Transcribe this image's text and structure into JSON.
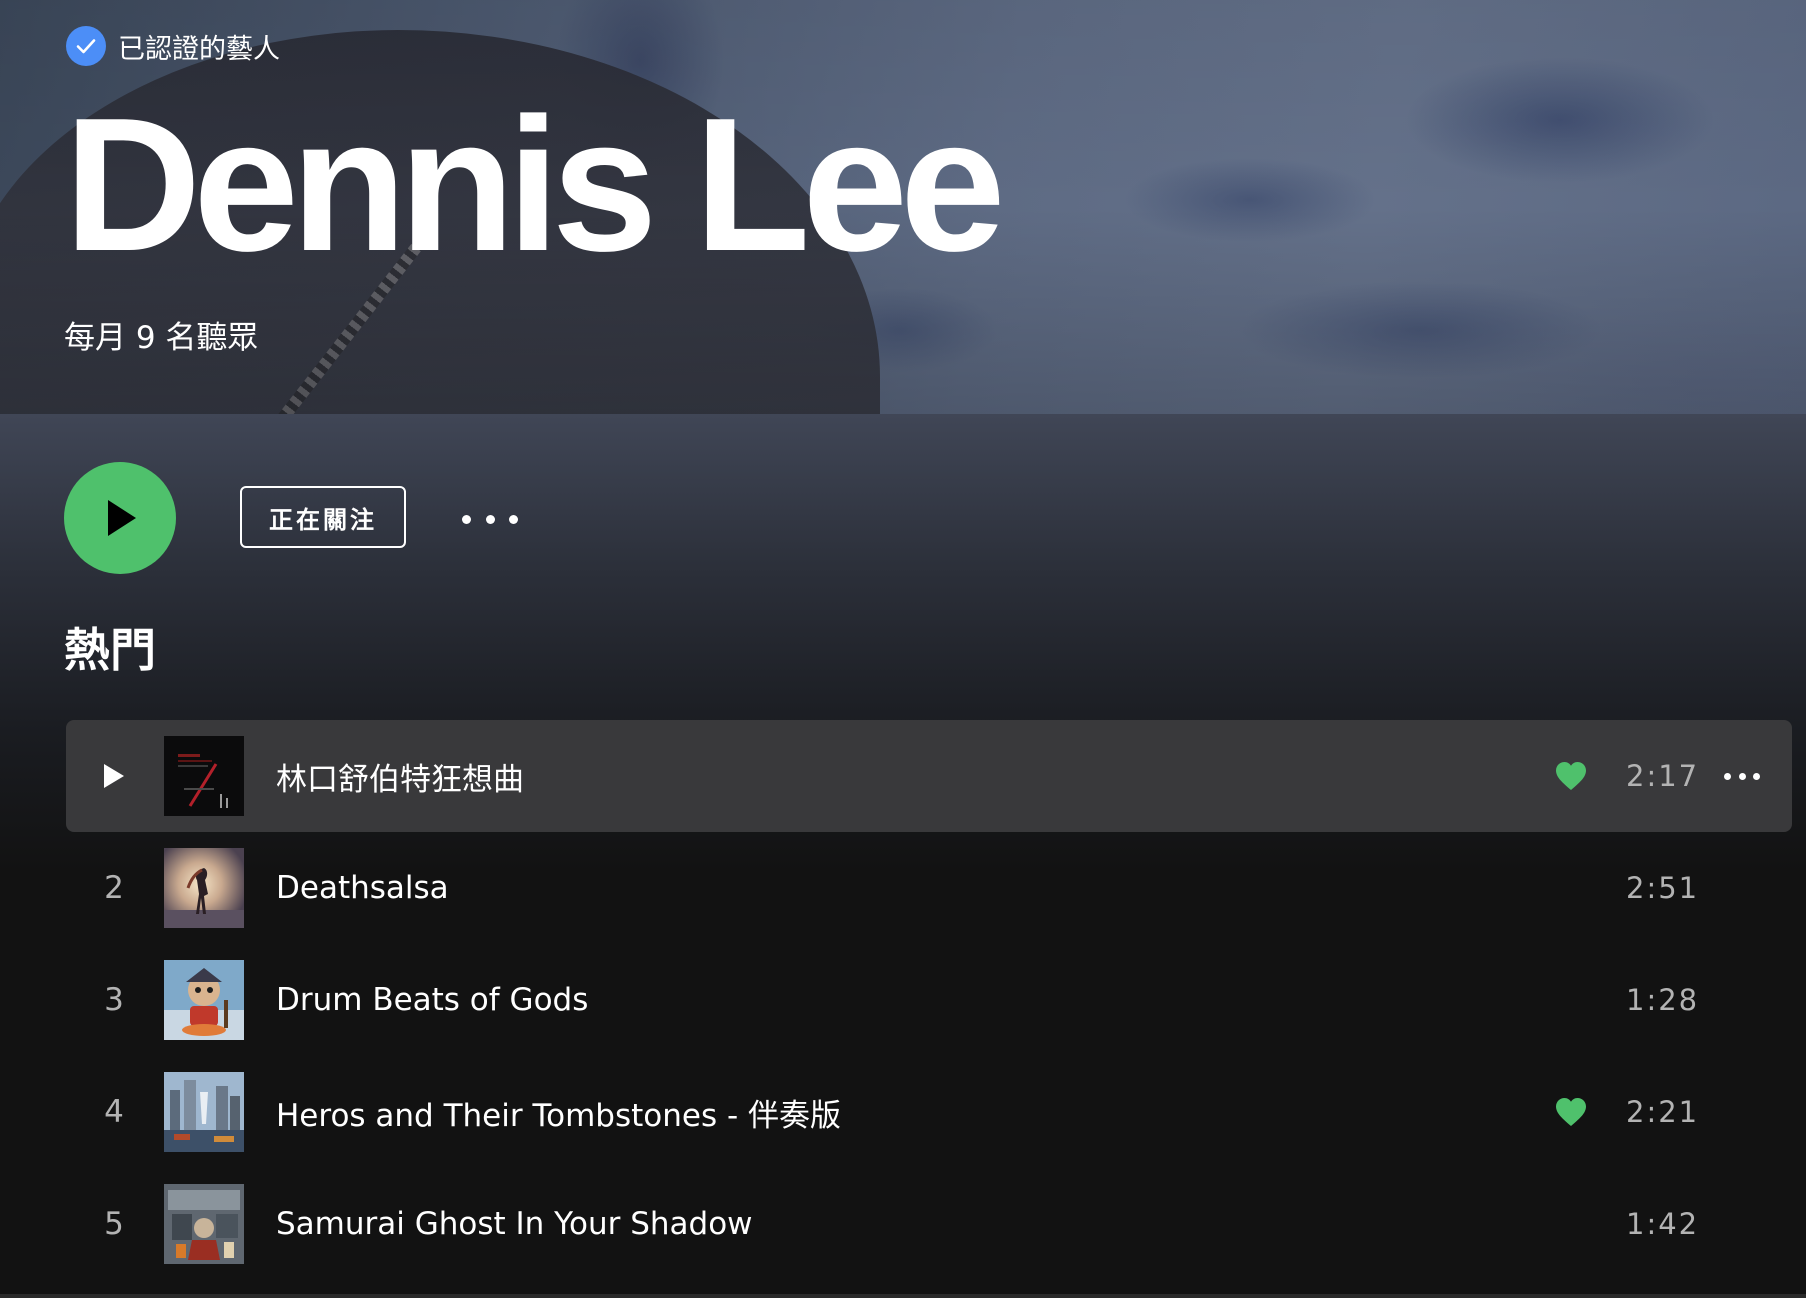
{
  "artist": {
    "verified_label": "已認證的藝人",
    "name": "Dennis Lee",
    "monthly_listeners": "每月 9 名聽眾"
  },
  "actions": {
    "follow_label": "正在關注",
    "play_icon": "play-icon",
    "more_icon": "more-icon"
  },
  "popular": {
    "section_title": "熱門",
    "tracks": [
      {
        "index": "1",
        "title": "林口舒伯特狂想曲",
        "duration": "2:17",
        "liked": true,
        "hovered": true
      },
      {
        "index": "2",
        "title": "Deathsalsa",
        "duration": "2:51",
        "liked": false,
        "hovered": false
      },
      {
        "index": "3",
        "title": "Drum Beats of Gods",
        "duration": "1:28",
        "liked": false,
        "hovered": false
      },
      {
        "index": "4",
        "title": "Heros and Their Tombstones - 伴奏版",
        "duration": "2:21",
        "liked": true,
        "hovered": false
      },
      {
        "index": "5",
        "title": "Samurai Ghost In Your Shadow",
        "duration": "1:42",
        "liked": false,
        "hovered": false
      }
    ]
  },
  "colors": {
    "accent_green": "#4fc16c",
    "verified_blue": "#4c8ef7",
    "background": "#121212",
    "hover_row": "#39393b",
    "muted_text": "#b3b3b3"
  }
}
